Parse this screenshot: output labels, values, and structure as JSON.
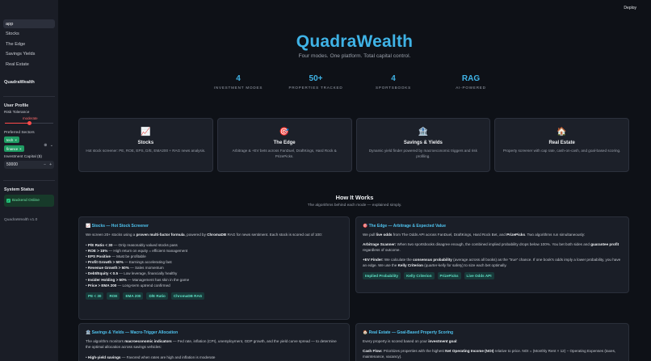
{
  "sidebar": {
    "nav": [
      "app",
      "Stocks",
      "The Edge",
      "Savings Yields",
      "Real Estate"
    ],
    "brand": "QuadraWealth",
    "user_profile_heading": "User Profile",
    "risk_label": "Risk Tolerance",
    "risk_value": "moderate",
    "risk_level_fraction": 0.5,
    "sectors_label": "Preferred Sectors",
    "sectors": [
      "tech",
      "finance"
    ],
    "sectors_ctrl": "⊗ ⌄",
    "capital_label": "Investment Capital ($)",
    "capital_value": "50000",
    "capital_minus": "−",
    "capital_plus": "+",
    "system_status_heading": "System Status",
    "backend_status": "Backend Online",
    "version": "QuadraWealth v1.0"
  },
  "header": {
    "deploy_label": "Deploy"
  },
  "hero": {
    "title": "QuadraWealth",
    "subtitle": "Four modes. One platform. Total capital control."
  },
  "metrics": [
    {
      "value": "4",
      "label": "INVESTMENT MODES"
    },
    {
      "value": "50+",
      "label": "PROPERTIES TRACKED"
    },
    {
      "value": "4",
      "label": "SPORTSBOOKS"
    },
    {
      "value": "RAG",
      "label": "AI-POWERED"
    }
  ],
  "modes": [
    {
      "icon": "📈",
      "title": "Stocks",
      "desc": "Hot stock screener: PE, ROE, EPS, D/E, EMA200 + RAG news analysis."
    },
    {
      "icon": "🎯",
      "title": "The Edge",
      "desc": "Arbitrage & +EV bets across FanDuel, DraftKings, Hard Rock & PrizePicks."
    },
    {
      "icon": "🏦",
      "title": "Savings & Yields",
      "desc": "Dynamic yield finder powered by macroeconomic triggers and risk profiling."
    },
    {
      "icon": "🏠",
      "title": "Real Estate",
      "desc": "Property screener with cap rate, cash-on-cash, and goal-based scoring."
    }
  ],
  "how": {
    "title": "How It Works",
    "subtitle": "The algorithms behind each mode — explained simply."
  },
  "algos": {
    "stocks": {
      "heading": "📈 Stocks — Hot Stock Screener",
      "intro_a": "We screen 20+ stocks using a ",
      "intro_b": "proven multi-factor formula",
      "intro_c": ", powered by ",
      "intro_d": "ChromaDB",
      "intro_e": " RAG for news sentiment. Each stock is scored out of 100:",
      "bullets": [
        {
          "k": "P/E Ratio < 30",
          "v": " — Only reasonably valued stocks pass"
        },
        {
          "k": "ROE > 15%",
          "v": " — High return on equity = efficient management"
        },
        {
          "k": "EPS Positive",
          "v": " — Must be profitable"
        },
        {
          "k": "Profit Growth > 50%",
          "v": " — Earnings accelerating fast"
        },
        {
          "k": "Revenue Growth > 50%",
          "v": " — Sales momentum"
        },
        {
          "k": "Debt/Equity < 0.5",
          "v": " — Low leverage, financially healthy"
        },
        {
          "k": "Insider Holding > 50%",
          "v": " — Management has skin in the game"
        },
        {
          "k": "Price > EMA 200",
          "v": " — Long-term uptrend confirmed"
        }
      ],
      "tags": [
        "PE < 30",
        "ROE",
        "EMA 200",
        "D/E Ratio",
        "ChromaDB RAG"
      ]
    },
    "edge": {
      "heading": "🎯 The Edge — Arbitrage & Expected Value",
      "intro_a": "We pull ",
      "intro_b": "live odds",
      "intro_c": " from The Odds API across FanDuel, DraftKings, Hard Rock Bet, and ",
      "intro_d": "PrizePicks",
      "intro_e": ". Two algorithms run simultaneously:",
      "arb_k": "Arbitrage Scanner:",
      "arb_a": " When two sportsbooks disagree enough, the combined implied probability drops below 100%. You bet both sides and ",
      "arb_b": "guarantee profit",
      "arb_c": " regardless of outcome.",
      "ev_k": "+EV Finder:",
      "ev_a": " We calculate the ",
      "ev_b": "consensus probability",
      "ev_c": " (average across all books) as the \"true\" chance. If one book's odds imply a lower probability, you have an edge. We use the ",
      "ev_d": "Kelly Criterion",
      "ev_e": " (quarter-kelly for safety) to size each bet optimally.",
      "tags": [
        "Implied Probability",
        "Kelly Criterion",
        "PrizePicks",
        "Live Odds API"
      ]
    },
    "savings": {
      "heading": "🏦 Savings & Yields — Macro-Trigger Allocation",
      "intro_a": "The algorithm monitors ",
      "intro_b": "macroeconomic indicators",
      "intro_c": " — Fed rate, inflation (CPI), unemployment, GDP growth, and the yield curve spread — to determine the optimal allocation across savings vehicles:",
      "bullet_k": "High-yield savings",
      "bullet_v": " — Favored when rates are high and inflation is moderate"
    },
    "realestate": {
      "heading": "🏠 Real Estate — Goal-Based Property Scoring",
      "intro_a": "Every property is scored based on your ",
      "intro_b": "investment goal",
      "intro_c": ":",
      "cf_k": "Cash Flow:",
      "cf_a": " Prioritizes properties with the highest ",
      "cf_b": "Net Operating Income (NOI)",
      "cf_c": " relative to price. NOI = (Monthly Rent × 12) − Operating Expenses (taxes, maintenance, vacancy)."
    }
  }
}
